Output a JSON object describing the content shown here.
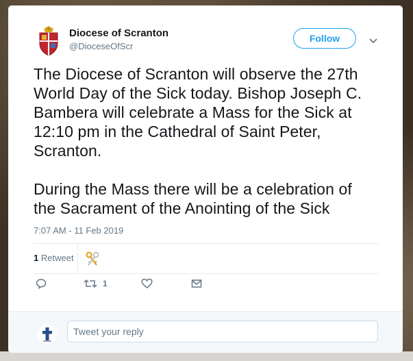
{
  "account": {
    "name": "Diocese of Scranton",
    "handle": "@DioceseOfScr",
    "follow_label": "Follow"
  },
  "tweet": {
    "paragraphs": [
      "The Diocese of Scranton will observe the 27th\nWorld Day of the Sick today. Bishop Joseph C.\nBambera will celebrate a Mass for the Sick at\n12:10 pm in the Cathedral of Saint Peter,\nScranton.",
      "During the Mass there will be a celebration of\nthe Sacrament of the Anointing of the Sick"
    ],
    "timestamp": "7:07 AM - 11 Feb 2019"
  },
  "stats": {
    "retweet_count": "1",
    "retweet_label": "Retweet"
  },
  "actions": {
    "retweet_count": "1"
  },
  "reply": {
    "placeholder": "Tweet your reply"
  },
  "colors": {
    "accent": "#1da1f2",
    "secondary_text": "#657786",
    "primary_text": "#14171a"
  },
  "icons": [
    "diocese-crest-icon",
    "chevron-down-icon",
    "crossed-keys-icon",
    "reply-icon",
    "retweet-icon",
    "heart-icon",
    "mail-icon",
    "cross-avatar-icon"
  ]
}
